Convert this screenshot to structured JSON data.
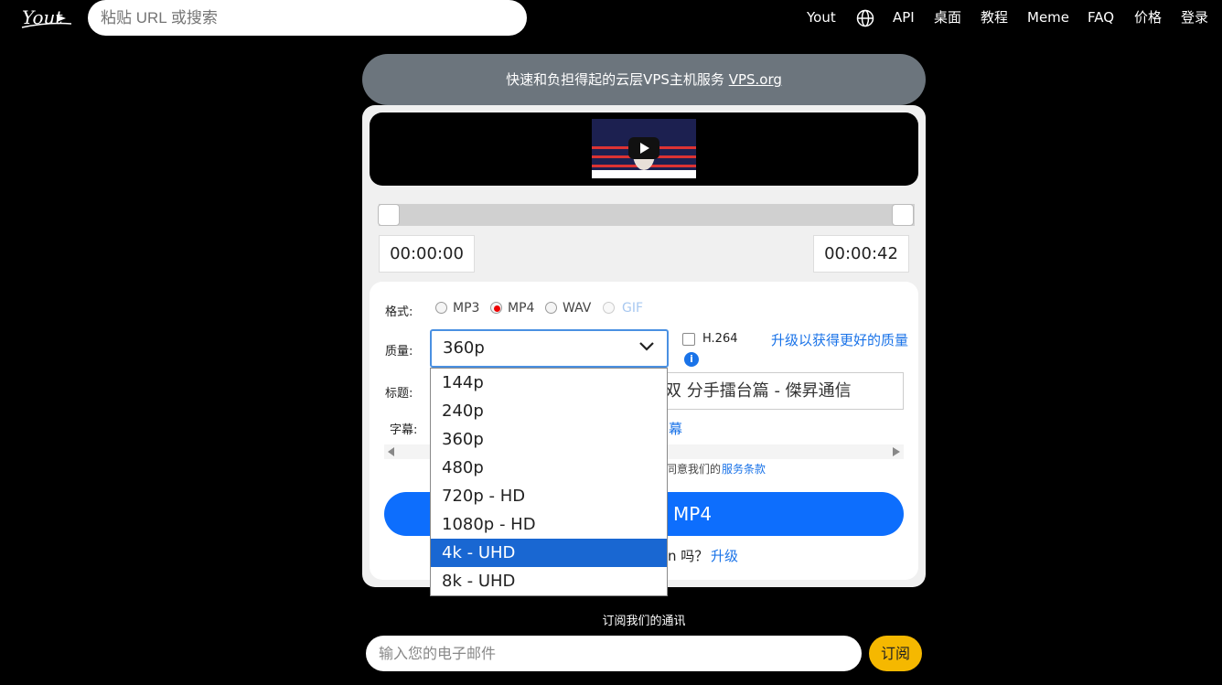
{
  "header": {
    "logo_text": "Yout",
    "search_placeholder": "粘贴 URL 或搜索",
    "nav": {
      "yout": "Yout",
      "api": "API",
      "desktop": "桌面",
      "tutorial": "教程",
      "meme": "Meme",
      "faq": "FAQ",
      "pricing": "价格",
      "login": "登录"
    }
  },
  "promo": {
    "text": "快速和负担得起的云层VPS主机服务",
    "link": "VPS.org"
  },
  "player": {
    "start_time": "00:00:00",
    "end_time": "00:00:42"
  },
  "form": {
    "format_label": "格式:",
    "formats": [
      "MP3",
      "MP4",
      "WAV",
      "GIF"
    ],
    "selected_format": "MP4",
    "quality_label": "质量:",
    "quality_value": "360p",
    "h264_label": "H.264",
    "info_symbol": "i",
    "upgrade_quality": "升级以获得更好的质量",
    "title_label": "标题:",
    "title_value_visible": "分手擂台篇 - 傑昇通信",
    "title_value_prefix": "双",
    "subtitle_label": "字幕:",
    "subtitle_partial": "幕",
    "terms_partial": "同意我们的",
    "terms_link": "服务条款",
    "download_partial": "MP4",
    "upgrade_partial": "n 吗？",
    "upgrade_link": "升级"
  },
  "dropdown": {
    "options": [
      "144p",
      "240p",
      "360p",
      "480p",
      "720p - HD",
      "1080p - HD",
      "4k - UHD",
      "8k - UHD"
    ],
    "highlighted": "4k - UHD"
  },
  "newsletter": {
    "title": "订阅我们的通讯",
    "email_placeholder": "输入您的电子邮件",
    "subscribe": "订阅"
  },
  "colors": {
    "primary": "#0d6efd",
    "promo_bg": "#6c757d",
    "subscribe_bg": "#f5b800",
    "dropdown_highlight": "#1967d2"
  }
}
